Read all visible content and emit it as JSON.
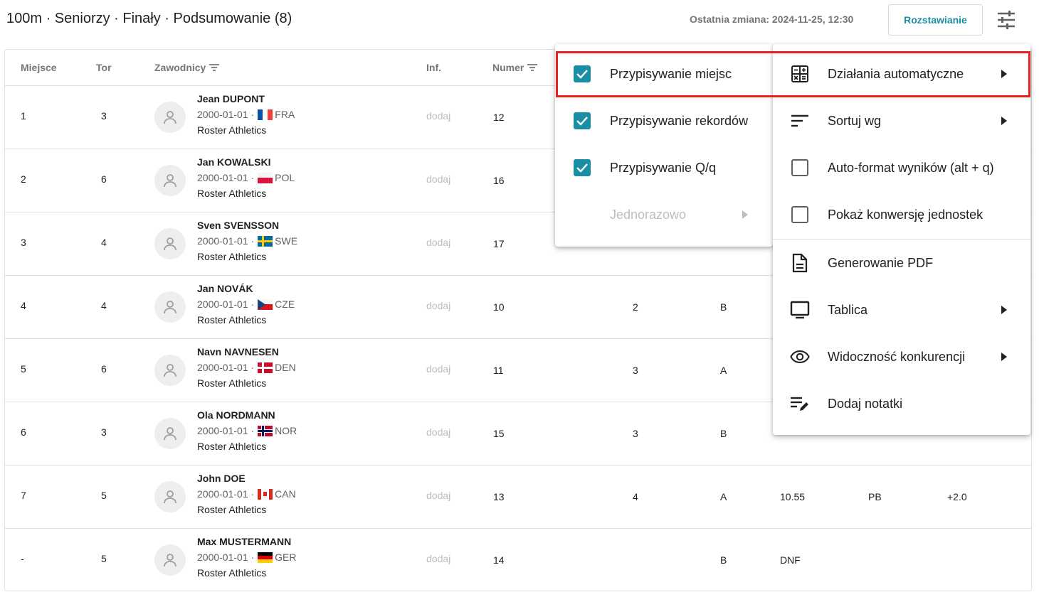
{
  "header": {
    "title": "100m · Seniorzy · Finały · Podsumowanie (8)",
    "last_change": "Ostatnia zmiana: 2024-11-25, 12:30",
    "seed_button": "Rozstawianie",
    "settings_icon": "tune-icon"
  },
  "table": {
    "columns": {
      "place": "Miejsce",
      "lane": "Tor",
      "athletes": "Zawodnicy",
      "info": "Inf.",
      "number": "Numer"
    },
    "rows": [
      {
        "place": "1",
        "lane": "3",
        "name": "Jean DUPONT",
        "dob": "2000-01-01 ·",
        "country": "FRA",
        "club": "Roster Athletics",
        "info": "dodaj",
        "number": "12",
        "heat": "",
        "group": "",
        "result": "",
        "record": "",
        "wind": ""
      },
      {
        "place": "2",
        "lane": "6",
        "name": "Jan KOWALSKI",
        "dob": "2000-01-01 ·",
        "country": "POL",
        "club": "Roster Athletics",
        "info": "dodaj",
        "number": "16",
        "heat": "",
        "group": "",
        "result": "",
        "record": "",
        "wind": ""
      },
      {
        "place": "3",
        "lane": "4",
        "name": "Sven SVENSSON",
        "dob": "2000-01-01 ·",
        "country": "SWE",
        "club": "Roster Athletics",
        "info": "dodaj",
        "number": "17",
        "heat": "",
        "group": "",
        "result": "",
        "record": "",
        "wind": ""
      },
      {
        "place": "4",
        "lane": "4",
        "name": "Jan NOVÁK",
        "dob": "2000-01-01 ·",
        "country": "CZE",
        "club": "Roster Athletics",
        "info": "dodaj",
        "number": "10",
        "heat": "2",
        "group": "B",
        "result": "",
        "record": "",
        "wind": ""
      },
      {
        "place": "5",
        "lane": "6",
        "name": "Navn NAVNESEN",
        "dob": "2000-01-01 ·",
        "country": "DEN",
        "club": "Roster Athletics",
        "info": "dodaj",
        "number": "11",
        "heat": "3",
        "group": "A",
        "result": "",
        "record": "",
        "wind": ""
      },
      {
        "place": "6",
        "lane": "3",
        "name": "Ola NORDMANN",
        "dob": "2000-01-01 ·",
        "country": "NOR",
        "club": "Roster Athletics",
        "info": "dodaj",
        "number": "15",
        "heat": "3",
        "group": "B",
        "result": "",
        "record": "",
        "wind": ""
      },
      {
        "place": "7",
        "lane": "5",
        "name": "John DOE",
        "dob": "2000-01-01 ·",
        "country": "CAN",
        "club": "Roster Athletics",
        "info": "dodaj",
        "number": "13",
        "heat": "4",
        "group": "A",
        "result": "10.55",
        "record": "PB",
        "wind": "+2.0"
      },
      {
        "place": "-",
        "lane": "5",
        "name": "Max MUSTERMANN",
        "dob": "2000-01-01 ·",
        "country": "GER",
        "club": "Roster Athletics",
        "info": "dodaj",
        "number": "14",
        "heat": "",
        "group": "B",
        "result": "DNF",
        "record": "",
        "wind": ""
      }
    ]
  },
  "submenu": {
    "items": [
      {
        "label": "Przypisywanie miejsc",
        "checked": true
      },
      {
        "label": "Przypisywanie rekordów",
        "checked": true
      },
      {
        "label": "Przypisywanie Q/q",
        "checked": true
      },
      {
        "label": "Jednorazowo",
        "disabled": true
      }
    ]
  },
  "menu": {
    "items": [
      {
        "label": "Działania automatyczne",
        "icon": "calculator-icon"
      },
      {
        "label": "Sortuj wg",
        "icon": "sort-icon"
      },
      {
        "label": "Auto-format wyników (alt + q)",
        "checked": false
      },
      {
        "label": "Pokaż konwersję jednostek",
        "checked": false
      },
      {
        "label": "Generowanie PDF",
        "icon": "document-icon"
      },
      {
        "label": "Tablica",
        "icon": "monitor-icon"
      },
      {
        "label": "Widoczność konkurencji",
        "icon": "eye-icon"
      },
      {
        "label": "Dodaj notatki",
        "icon": "edit-note-icon"
      }
    ]
  },
  "colors": {
    "accent": "#1a8fa3",
    "highlight": "#e52222"
  }
}
